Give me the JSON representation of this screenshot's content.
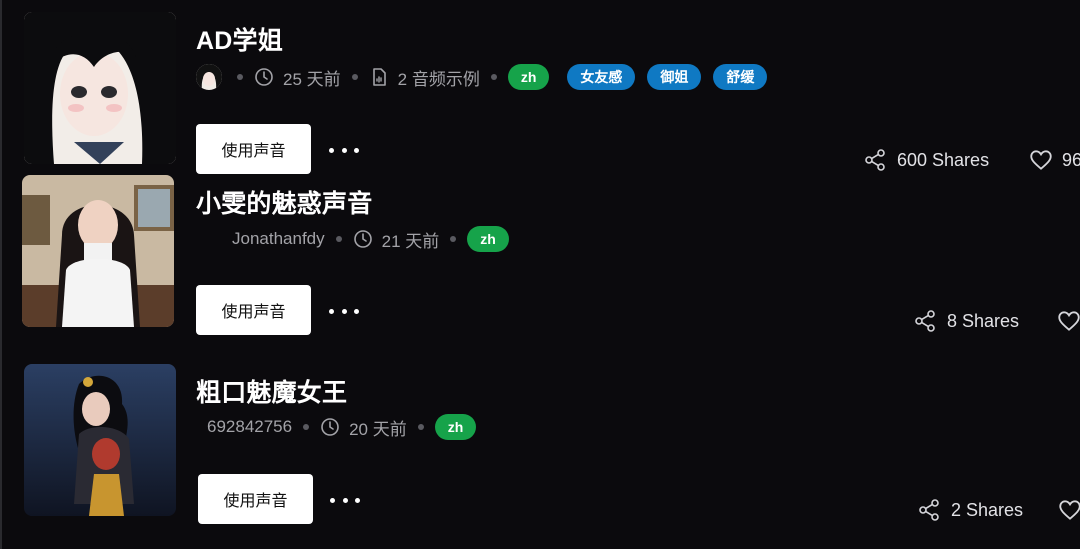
{
  "voices": [
    {
      "title": "AD学姐",
      "author": "",
      "time_ago": "25 天前",
      "samples": "2 音频示例",
      "lang": "zh",
      "tags": [
        "女友感",
        "御姐",
        "舒缓"
      ],
      "use_label": "使用声音",
      "shares": "600 Shares",
      "likes": "96"
    },
    {
      "title": "小雯的魅惑声音",
      "author": "Jonathanfdy",
      "time_ago": "21 天前",
      "lang": "zh",
      "use_label": "使用声音",
      "shares": "8 Shares"
    },
    {
      "title": "粗口魅魔女王",
      "author": "692842756",
      "time_ago": "20 天前",
      "lang": "zh",
      "use_label": "使用声音",
      "shares": "2 Shares"
    }
  ],
  "colors": {
    "background": "#0b0a0d",
    "lang_badge": "#16a34a",
    "tag_badge": "#0f79c3",
    "button_bg": "#ffffff"
  },
  "icons": [
    "clock-icon",
    "audio-file-icon",
    "share-icon",
    "heart-icon",
    "more-icon"
  ]
}
